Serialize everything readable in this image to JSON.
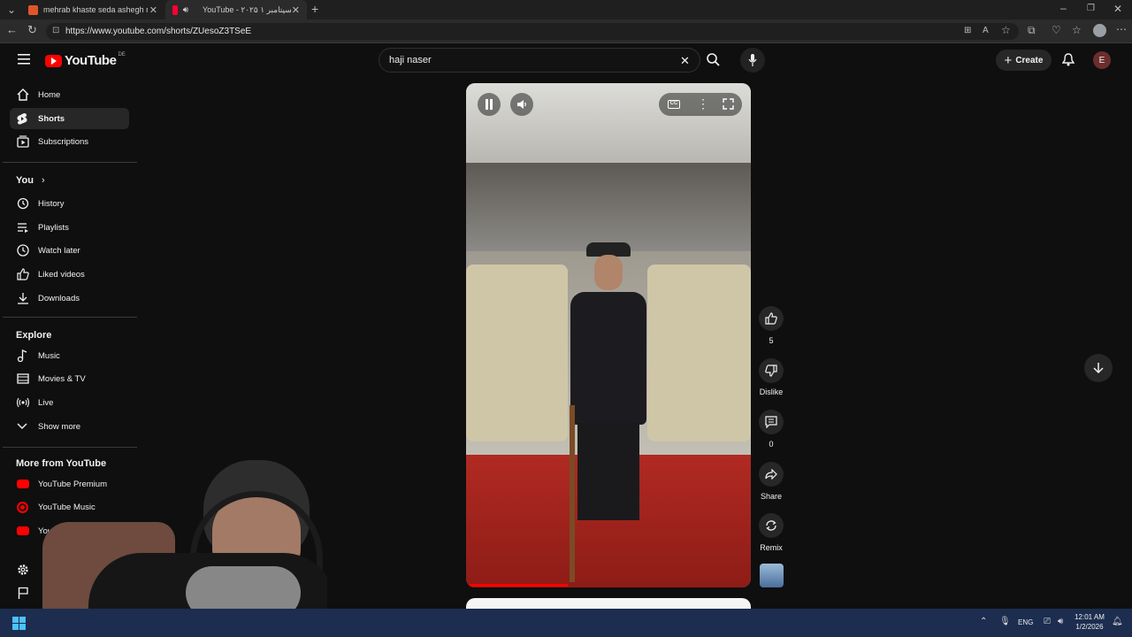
{
  "browser": {
    "tabs": [
      {
        "title": "mehrab khaste seda ashegh resu",
        "favicon": "youtube-icon"
      },
      {
        "title": "YouTube - ۲۰۲۵ سپتامبر ۱",
        "favicon": "youtube-icon",
        "audio": true
      }
    ],
    "url": "https://www.youtube.com/shorts/ZUesoZ3TSeE"
  },
  "header": {
    "logo_text": "YouTube",
    "logo_region": "DE",
    "search_value": "haji naser",
    "create_label": "Create",
    "avatar_letter": "E"
  },
  "sidebar": {
    "main": [
      {
        "label": "Home",
        "icon": "home-icon"
      },
      {
        "label": "Shorts",
        "icon": "shorts-icon",
        "active": true
      },
      {
        "label": "Subscriptions",
        "icon": "subscriptions-icon"
      }
    ],
    "you_title": "You",
    "you": [
      {
        "label": "History",
        "icon": "history-icon"
      },
      {
        "label": "Playlists",
        "icon": "playlists-icon"
      },
      {
        "label": "Watch later",
        "icon": "clock-icon"
      },
      {
        "label": "Liked videos",
        "icon": "thumb-up-icon"
      },
      {
        "label": "Downloads",
        "icon": "download-icon"
      }
    ],
    "explore_title": "Explore",
    "explore": [
      {
        "label": "Music",
        "icon": "music-icon"
      },
      {
        "label": "Movies & TV",
        "icon": "movies-icon"
      },
      {
        "label": "Live",
        "icon": "live-icon"
      },
      {
        "label": "Show more",
        "icon": "chevron-down-icon"
      }
    ],
    "more_title": "More from YouTube",
    "more": [
      {
        "label": "YouTube Premium",
        "icon": "youtube-premium-icon"
      },
      {
        "label": "YouTube Music",
        "icon": "youtube-music-icon"
      },
      {
        "label": "You",
        "icon": "youtube-kids-icon"
      }
    ]
  },
  "shorts_actions": {
    "likes": "5",
    "dislike": "Dislike",
    "comments": "0",
    "share": "Share",
    "remix": "Remix"
  },
  "taskbar": {
    "lang": "ENG",
    "time": "12:01 AM",
    "date": "1/2/2026"
  },
  "colors": {
    "yt_red": "#ff0000",
    "background": "#0f0f0f",
    "taskbar": "#1c2d4f"
  }
}
